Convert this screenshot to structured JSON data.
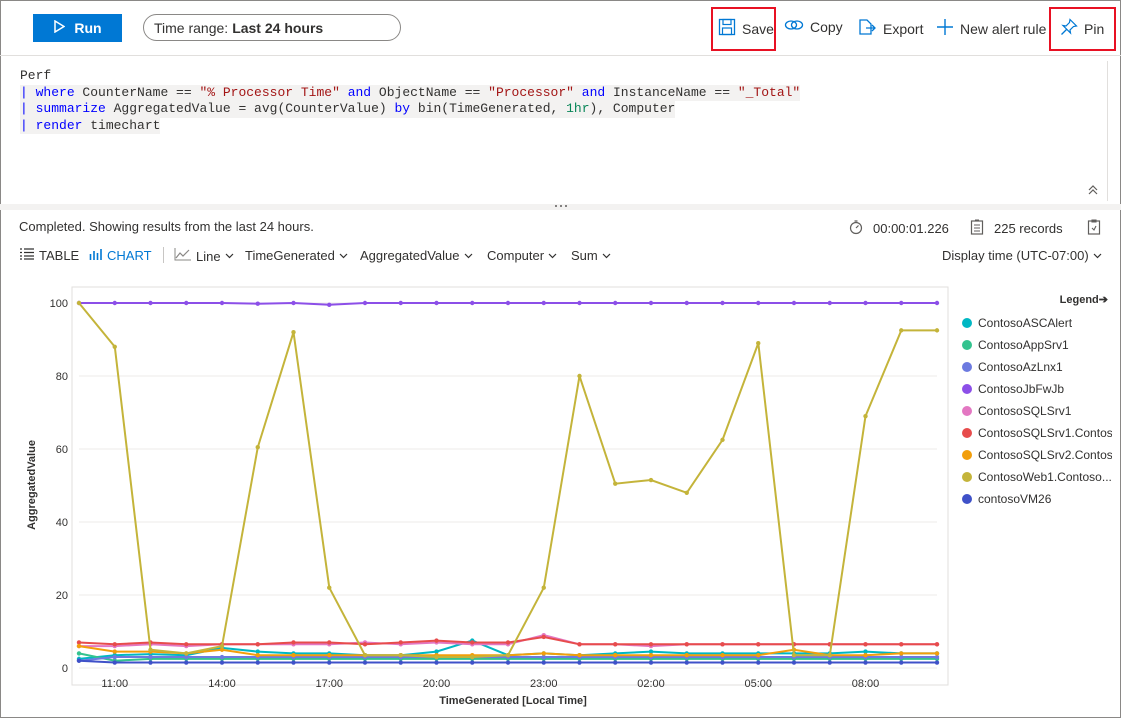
{
  "toolbar": {
    "run_label": "Run",
    "time_range_prefix": "Time range:",
    "time_range_value": "Last 24 hours",
    "save_label": "Save",
    "copy_label": "Copy",
    "export_label": "Export",
    "new_alert_label": "New alert rule",
    "pin_label": "Pin"
  },
  "query": {
    "l1": "Perf",
    "l2_pipe": "| ",
    "l2_kw": "where",
    "l2_a": " CounterName == ",
    "l2_s1": "\"% Processor Time\"",
    "l2_and1": " and",
    "l2_b": " ObjectName == ",
    "l2_s2": "\"Processor\"",
    "l2_and2": " and",
    "l2_c": " InstanceName == ",
    "l2_s3": "\"_Total\"",
    "l3_pipe": "| ",
    "l3_kw": "summarize",
    "l3_a": " AggregatedValue = avg(CounterValue) ",
    "l3_by": "by",
    "l3_b": " bin(TimeGenerated, ",
    "l3_n": "1hr",
    "l3_c": "), Computer",
    "l4_pipe": "| ",
    "l4_kw": "render",
    "l4_a": " timechart"
  },
  "results": {
    "status": "Completed. Showing results from the last 24 hours.",
    "duration": "00:00:01.226",
    "records": "225 records"
  },
  "viewbar": {
    "table": "TABLE",
    "chart": "CHART",
    "line": "Line",
    "x_col": "TimeGenerated",
    "y_col": "AggregatedValue",
    "split_col": "Computer",
    "agg": "Sum",
    "display_time": "Display time (UTC-07:00)"
  },
  "colors": {
    "accent": "#0078d4",
    "highlight": "#e81123"
  },
  "chart_data": {
    "type": "line",
    "xlabel": "TimeGenerated [Local Time]",
    "ylabel": "AggregatedValue",
    "ylim": [
      0,
      100
    ],
    "yticks": [
      0,
      20,
      40,
      60,
      80,
      100
    ],
    "x_tick_labels": [
      "11:00",
      "14:00",
      "17:00",
      "20:00",
      "23:00",
      "02:00",
      "05:00",
      "08:00"
    ],
    "x_hours": [
      10,
      11,
      12,
      13,
      14,
      15,
      16,
      17,
      18,
      19,
      20,
      21,
      22,
      23,
      24,
      25,
      26,
      27,
      28,
      29,
      30,
      31,
      32,
      33,
      34
    ],
    "legend_title": "Legend",
    "legend": "right",
    "grid": "horizontal",
    "series": [
      {
        "name": "ContosoASCAlert",
        "color": "#00b7c3",
        "values": [
          2.5,
          3.5,
          3.8,
          3.5,
          5.5,
          4.5,
          4,
          4,
          3.5,
          3.5,
          4.5,
          7.5,
          3.5,
          4,
          3.5,
          4,
          4.5,
          4,
          4,
          4,
          4,
          4,
          4.5,
          4,
          4
        ]
      },
      {
        "name": "ContosoAppSrv1",
        "color": "#34c38f",
        "values": [
          4,
          2,
          2.5,
          2.5,
          2.5,
          2.5,
          2.5,
          2.5,
          2.5,
          2.5,
          2.5,
          2.5,
          2.5,
          2.5,
          2.5,
          2.5,
          2.5,
          2.5,
          2.5,
          2.5,
          2.5,
          2.5,
          2.5,
          2.5,
          2.5
        ]
      },
      {
        "name": "ContosoAzLnx1",
        "color": "#6c7ae0",
        "values": [
          2,
          3,
          3,
          3,
          3,
          3,
          3,
          3,
          3,
          3,
          3,
          3,
          3,
          3,
          3,
          3,
          3,
          3,
          3,
          3,
          3,
          3,
          3,
          3,
          3
        ]
      },
      {
        "name": "ContosoJbFwJb",
        "color": "#8c4fe8",
        "values": [
          100,
          100,
          100,
          100,
          100,
          99.8,
          100,
          99.5,
          100,
          100,
          100,
          100,
          100,
          100,
          100,
          100,
          100,
          100,
          100,
          100,
          100,
          100,
          100,
          100,
          100
        ]
      },
      {
        "name": "ContosoSQLSrv1",
        "color": "#e377c2",
        "values": [
          6,
          6,
          6.5,
          6,
          6.5,
          6.5,
          6.5,
          6.5,
          7,
          6.5,
          7,
          6.5,
          6.5,
          9,
          6.5,
          6.5,
          6,
          6.5,
          6.5,
          6.5,
          6.5,
          6.5,
          6.5,
          6.5,
          6.5
        ]
      },
      {
        "name": "ContosoSQLSrv1.Contoso...",
        "color": "#e74c4c",
        "values": [
          7,
          6.5,
          7,
          6.5,
          6.5,
          6.5,
          7,
          7,
          6.5,
          7,
          7.5,
          7,
          7,
          8.5,
          6.5,
          6.5,
          6.5,
          6.5,
          6.5,
          6.5,
          6.5,
          6.5,
          6.5,
          6.5,
          6.5
        ]
      },
      {
        "name": "ContosoSQLSrv2.Contoso...",
        "color": "#f29e0b",
        "values": [
          6,
          4.5,
          4.5,
          4,
          5,
          3.5,
          3.5,
          3.5,
          3.5,
          3.5,
          3.5,
          3.5,
          3.5,
          4,
          3.5,
          3.5,
          3.5,
          3.5,
          3.5,
          3.5,
          5,
          3.5,
          3.5,
          4,
          4
        ]
      },
      {
        "name": "ContosoWeb1.Contoso...",
        "color": "#c4b43a",
        "values": [
          100,
          88,
          5,
          4,
          6,
          60.5,
          92,
          22,
          3.5,
          3.5,
          3,
          3,
          3.5,
          22,
          80,
          50.5,
          51.5,
          48,
          62.5,
          89,
          3.5,
          3.5,
          69,
          92.5,
          92.5
        ]
      },
      {
        "name": "contosoVM26",
        "color": "#3f51c8",
        "values": [
          2,
          1.5,
          1.5,
          1.5,
          1.5,
          1.5,
          1.5,
          1.5,
          1.5,
          1.5,
          1.5,
          1.5,
          1.5,
          1.5,
          1.5,
          1.5,
          1.5,
          1.5,
          1.5,
          1.5,
          1.5,
          1.5,
          1.5,
          1.5,
          1.5
        ]
      }
    ]
  }
}
